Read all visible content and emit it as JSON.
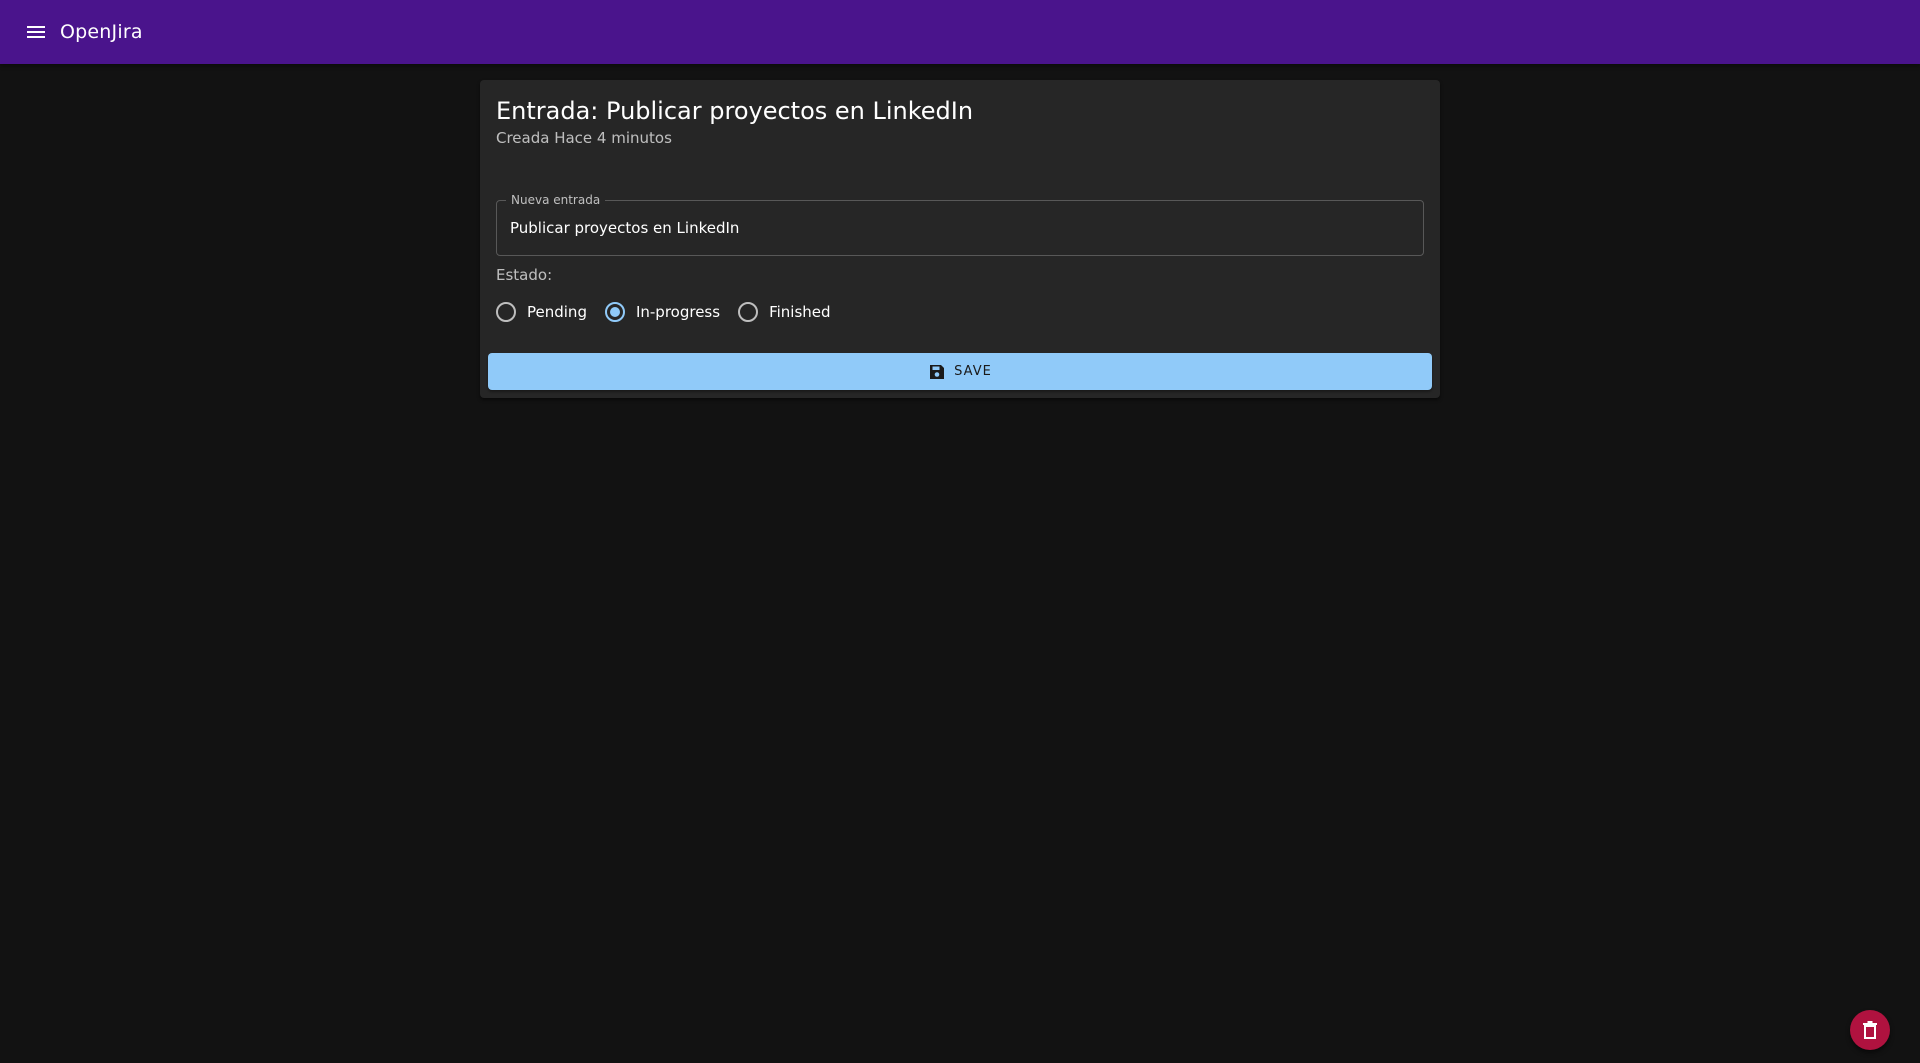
{
  "appbar": {
    "title": "OpenJira",
    "menu_icon": "menu-icon",
    "background_color": "#4a148c"
  },
  "entry": {
    "title": "Entrada: Publicar proyectos en LinkedIn",
    "subtitle": "Creada Hace 4 minutos",
    "input_label": "Nueva entrada",
    "input_value": "Publicar proyectos en LinkedIn",
    "status_label": "Estado:",
    "status_options": [
      {
        "label": "Pending",
        "selected": false
      },
      {
        "label": "In-progress",
        "selected": true
      },
      {
        "label": "Finished",
        "selected": false
      }
    ],
    "save_label": "Save",
    "save_icon": "save-icon",
    "accent_color": "#90caf9"
  },
  "fab": {
    "icon": "trash-icon",
    "color": "#b0123f"
  }
}
